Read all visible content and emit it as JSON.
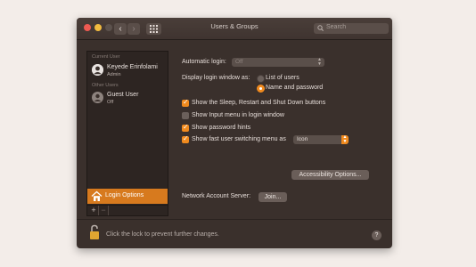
{
  "window": {
    "title": "Users & Groups"
  },
  "search": {
    "placeholder": "Search"
  },
  "sidebar": {
    "current_user_label": "Current User",
    "current_user": {
      "name": "Keyede Erinfolami",
      "role": "Admin"
    },
    "other_users_label": "Other Users",
    "guest": {
      "name": "Guest User",
      "role": "Off"
    },
    "login_options": "Login Options",
    "add_symbol": "+",
    "remove_symbol": "−"
  },
  "main": {
    "auto_login_label": "Automatic login:",
    "auto_login_value": "Off",
    "display_login_label": "Display login window as:",
    "radio_list": "List of users",
    "radio_name_pw": "Name and password",
    "opt_sleep": "Show the Sleep, Restart and Shut Down buttons",
    "opt_input_menu": "Show Input menu in login window",
    "opt_pw_hints": "Show password hints",
    "opt_fast_switch": "Show fast user switching menu as",
    "fast_switch_value": "Icon",
    "accessibility_button": "Accessibility Options...",
    "network_label": "Network Account Server:",
    "join_button": "Join..."
  },
  "footer": {
    "lock_text": "Click the lock to prevent further changes.",
    "help": "?"
  },
  "colors": {
    "accent": "#f08a1e",
    "selection": "#d77a1e",
    "window_bg": "#3a302c"
  }
}
